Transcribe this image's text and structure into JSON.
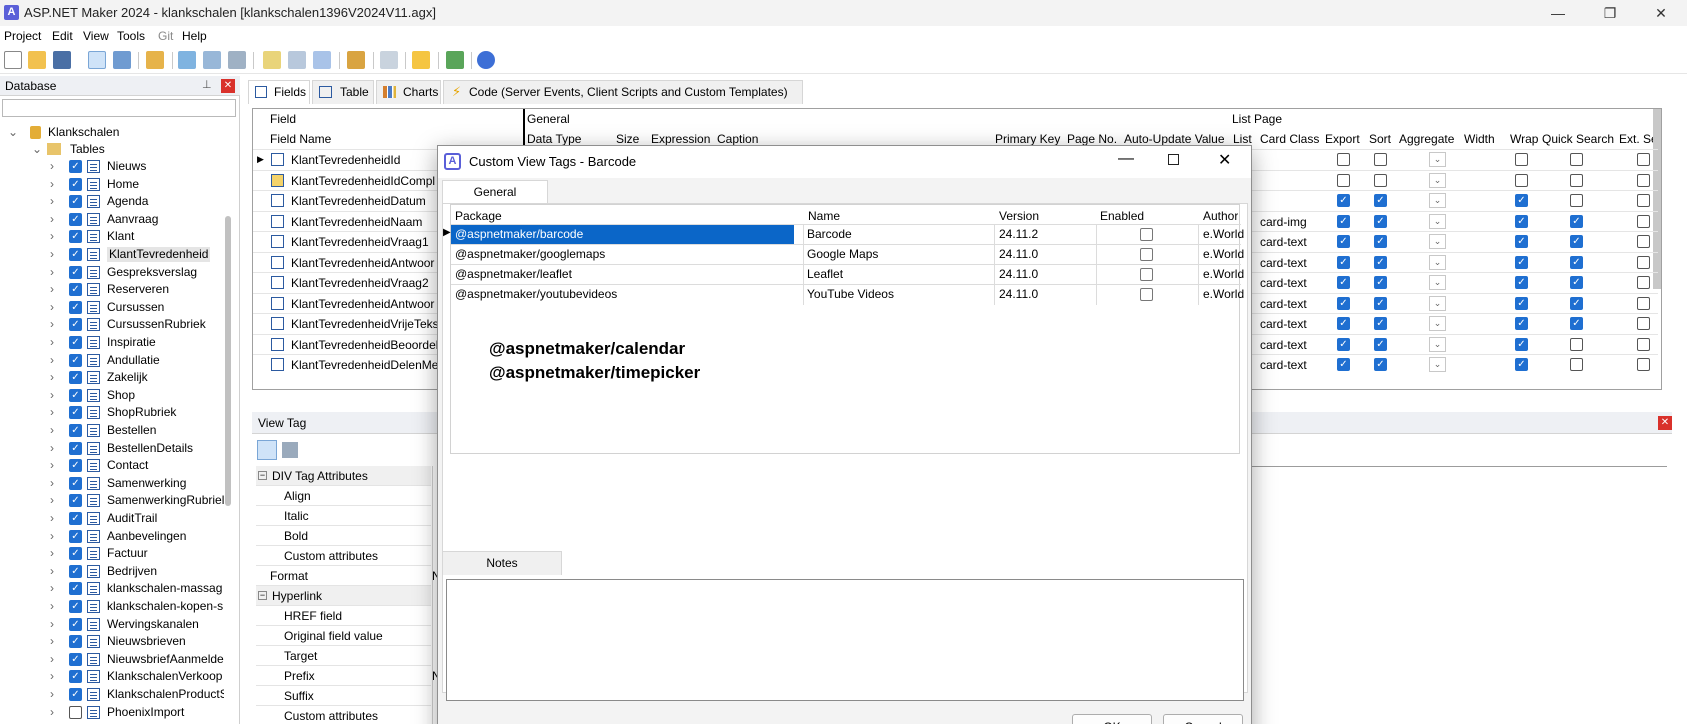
{
  "titlebar": {
    "title": "ASP.NET Maker 2024 - klankschalen [klankschalen1396V2024V11.agx]",
    "app_icon": "A"
  },
  "menu": [
    "Project",
    "Edit",
    "View",
    "Tools",
    "Git",
    "Help"
  ],
  "database_panel": {
    "title": "Database",
    "root": "Klankschalen",
    "tables_node": "Tables",
    "tables": [
      {
        "label": "Nieuws",
        "checked": true
      },
      {
        "label": "Home",
        "checked": true
      },
      {
        "label": "Agenda",
        "checked": true
      },
      {
        "label": "Aanvraag",
        "checked": true
      },
      {
        "label": "Klant",
        "checked": true
      },
      {
        "label": "KlantTevredenheid",
        "checked": true
      },
      {
        "label": "Gespreksverslag",
        "checked": true
      },
      {
        "label": "Reserveren",
        "checked": true
      },
      {
        "label": "Cursussen",
        "checked": true
      },
      {
        "label": "CursussenRubriek",
        "checked": true
      },
      {
        "label": "Inspiratie",
        "checked": true
      },
      {
        "label": "Andullatie",
        "checked": true
      },
      {
        "label": "Zakelijk",
        "checked": true
      },
      {
        "label": "Shop",
        "checked": true
      },
      {
        "label": "ShopRubriek",
        "checked": true
      },
      {
        "label": "Bestellen",
        "checked": true
      },
      {
        "label": "BestellenDetails",
        "checked": true
      },
      {
        "label": "Contact",
        "checked": true
      },
      {
        "label": "Samenwerking",
        "checked": true
      },
      {
        "label": "SamenwerkingRubriel",
        "checked": true
      },
      {
        "label": "AuditTrail",
        "checked": true
      },
      {
        "label": "Aanbevelingen",
        "checked": true
      },
      {
        "label": "Factuur",
        "checked": true
      },
      {
        "label": "Bedrijven",
        "checked": true
      },
      {
        "label": "klankschalen-massag",
        "checked": true
      },
      {
        "label": "klankschalen-kopen-s",
        "checked": true
      },
      {
        "label": "Wervingskanalen",
        "checked": true
      },
      {
        "label": "Nieuwsbrieven",
        "checked": true
      },
      {
        "label": "NieuwsbriefAanmelde",
        "checked": true
      },
      {
        "label": "KlankschalenVerkoop",
        "checked": true
      },
      {
        "label": "KlankschalenProductS",
        "checked": true
      },
      {
        "label": "PhoenixImport",
        "checked": false
      }
    ]
  },
  "tabs": [
    "Fields",
    "Table",
    "Charts",
    "Code (Server Events, Client Scripts and Custom Templates)"
  ],
  "grid": {
    "group_field": "Field",
    "group_general": "General",
    "group_list": "List Page",
    "col_fieldname": "Field Name",
    "cols_general": [
      "Data Type",
      "Size",
      "Expression",
      "Caption",
      "Primary Key",
      "Page No.",
      "Auto-Update Value"
    ],
    "cols_list": [
      "List",
      "Card Class",
      "Export",
      "Sort",
      "Aggregate",
      "Width",
      "Wrap",
      "Quick Search",
      "Ext. Se"
    ],
    "rows": [
      {
        "name": "KlantTevredenheidId",
        "card": "",
        "export": false,
        "sort": false,
        "wrap": false,
        "qs": false
      },
      {
        "name": "KlantTevredenheidIdCompl",
        "card": "",
        "export": false,
        "sort": false,
        "wrap": false,
        "qs": false
      },
      {
        "name": "KlantTevredenheidDatum",
        "card": "",
        "export": true,
        "sort": true,
        "wrap": true,
        "qs": false
      },
      {
        "name": "KlantTevredenheidNaam",
        "card": "card-img",
        "export": true,
        "sort": true,
        "wrap": true,
        "qs": true
      },
      {
        "name": "KlantTevredenheidVraag1",
        "card": "card-text",
        "export": true,
        "sort": true,
        "wrap": true,
        "qs": true
      },
      {
        "name": "KlantTevredenheidAntwoor",
        "card": "card-text",
        "export": true,
        "sort": true,
        "wrap": true,
        "qs": true
      },
      {
        "name": "KlantTevredenheidVraag2",
        "card": "card-text",
        "export": true,
        "sort": true,
        "wrap": true,
        "qs": true
      },
      {
        "name": "KlantTevredenheidAntwoor",
        "card": "card-text",
        "export": true,
        "sort": true,
        "wrap": true,
        "qs": true
      },
      {
        "name": "KlantTevredenheidVrijeTeks",
        "card": "card-text",
        "export": true,
        "sort": true,
        "wrap": true,
        "qs": true
      },
      {
        "name": "KlantTevredenheidBeoordel",
        "card": "card-text",
        "export": true,
        "sort": true,
        "wrap": true,
        "qs": false
      },
      {
        "name": "KlantTevredenheidDelenMe",
        "card": "card-text",
        "export": true,
        "sort": true,
        "wrap": true,
        "qs": false
      }
    ]
  },
  "view_tag": {
    "title": "View Tag",
    "props": [
      {
        "label": "DIV Tag Attributes",
        "group": true
      },
      {
        "label": "Align",
        "group": false
      },
      {
        "label": "Italic",
        "group": false
      },
      {
        "label": "Bold",
        "group": false
      },
      {
        "label": "Custom attributes",
        "group": false
      },
      {
        "label": "Format",
        "group": false,
        "top": true,
        "val": "N"
      },
      {
        "label": "Hyperlink",
        "group": true
      },
      {
        "label": "HREF field",
        "group": false
      },
      {
        "label": "Original field value",
        "group": false
      },
      {
        "label": "Target",
        "group": false
      },
      {
        "label": "Prefix",
        "group": false,
        "val": "N"
      },
      {
        "label": "Suffix",
        "group": false
      },
      {
        "label": "Custom attributes",
        "group": false
      }
    ]
  },
  "dialog": {
    "title": "Custom View Tags - Barcode",
    "tab": "General",
    "headers": [
      "Package",
      "Name",
      "Version",
      "Enabled",
      "Author"
    ],
    "packages": [
      {
        "package": "@aspnetmaker/barcode",
        "name": "Barcode",
        "version": "24.11.2",
        "enabled": false,
        "author": "e.World",
        "selected": true
      },
      {
        "package": "@aspnetmaker/googlemaps",
        "name": "Google Maps",
        "version": "24.11.0",
        "enabled": false,
        "author": "e.World",
        "selected": false
      },
      {
        "package": "@aspnetmaker/leaflet",
        "name": "Leaflet",
        "version": "24.11.0",
        "enabled": false,
        "author": "e.World",
        "selected": false
      },
      {
        "package": "@aspnetmaker/youtubevideos",
        "name": "YouTube Videos",
        "version": "24.11.0",
        "enabled": false,
        "author": "e.World",
        "selected": false
      }
    ],
    "annotation_line1": "@aspnetmaker/calendar",
    "annotation_line2": "@aspnetmaker/timepicker",
    "notes_tab": "Notes",
    "ok_label": "OK",
    "cancel_label": "Cancel"
  }
}
